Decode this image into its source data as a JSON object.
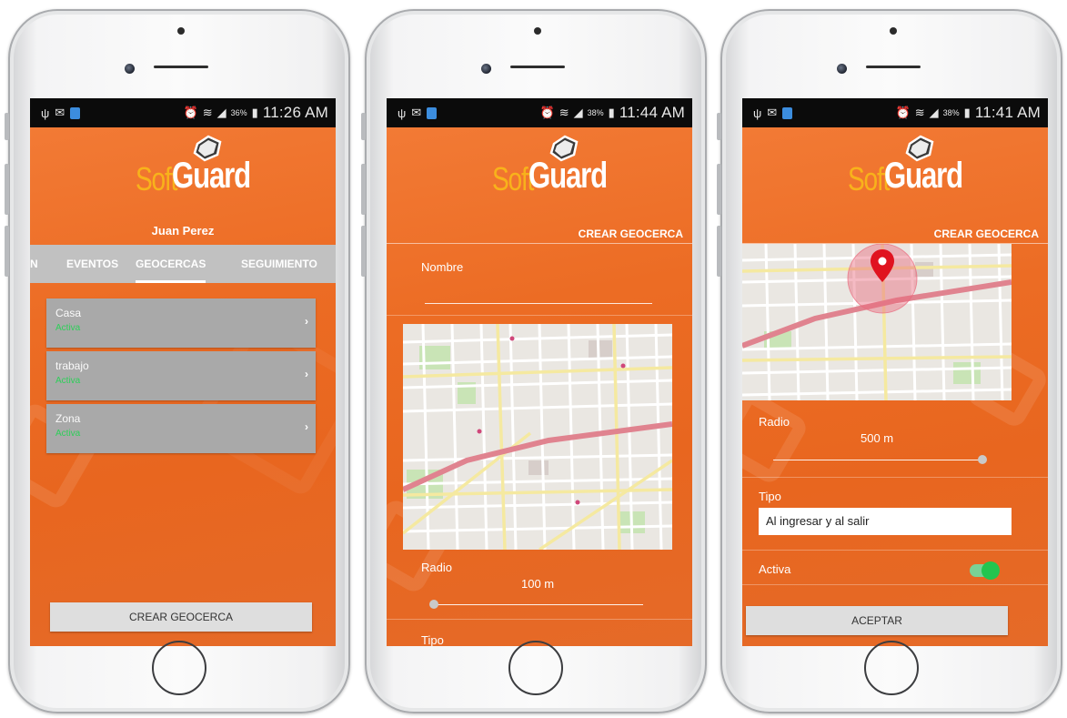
{
  "brand": {
    "soft": "Soft",
    "guard": "Guard",
    "orange": "#e8661f",
    "logo_yellow": "#f8b21b"
  },
  "phones": [
    {
      "status": {
        "battery": "36%",
        "time": "11:26 AM"
      },
      "user_name": "Juan Perez",
      "tabs": [
        {
          "label": "N",
          "active": false
        },
        {
          "label": "EVENTOS",
          "active": false
        },
        {
          "label": "GEOCERCAS",
          "active": true
        },
        {
          "label": "SEGUIMIENTO",
          "active": false
        }
      ],
      "geofences": [
        {
          "name": "Casa",
          "status": "Activa"
        },
        {
          "name": "trabajo",
          "status": "Activa"
        },
        {
          "name": "Zona",
          "status": "Activa"
        }
      ],
      "create_button": "CREAR GEOCERCA"
    },
    {
      "status": {
        "battery": "38%",
        "time": "11:44 AM"
      },
      "section_title": "CREAR GEOCERCA",
      "name_label": "Nombre",
      "name_value": "",
      "radius_label": "Radio",
      "radius_value": "100 m",
      "radius_fraction": 0.0,
      "type_label": "Tipo"
    },
    {
      "status": {
        "battery": "38%",
        "time": "11:41 AM"
      },
      "section_title": "CREAR GEOCERCA",
      "radius_label": "Radio",
      "radius_value": "500 m",
      "radius_fraction": 1.0,
      "type_label": "Tipo",
      "type_value": "Al ingresar y al salir",
      "active_label": "Activa",
      "active_on": true,
      "accept_button": "ACEPTAR"
    }
  ]
}
